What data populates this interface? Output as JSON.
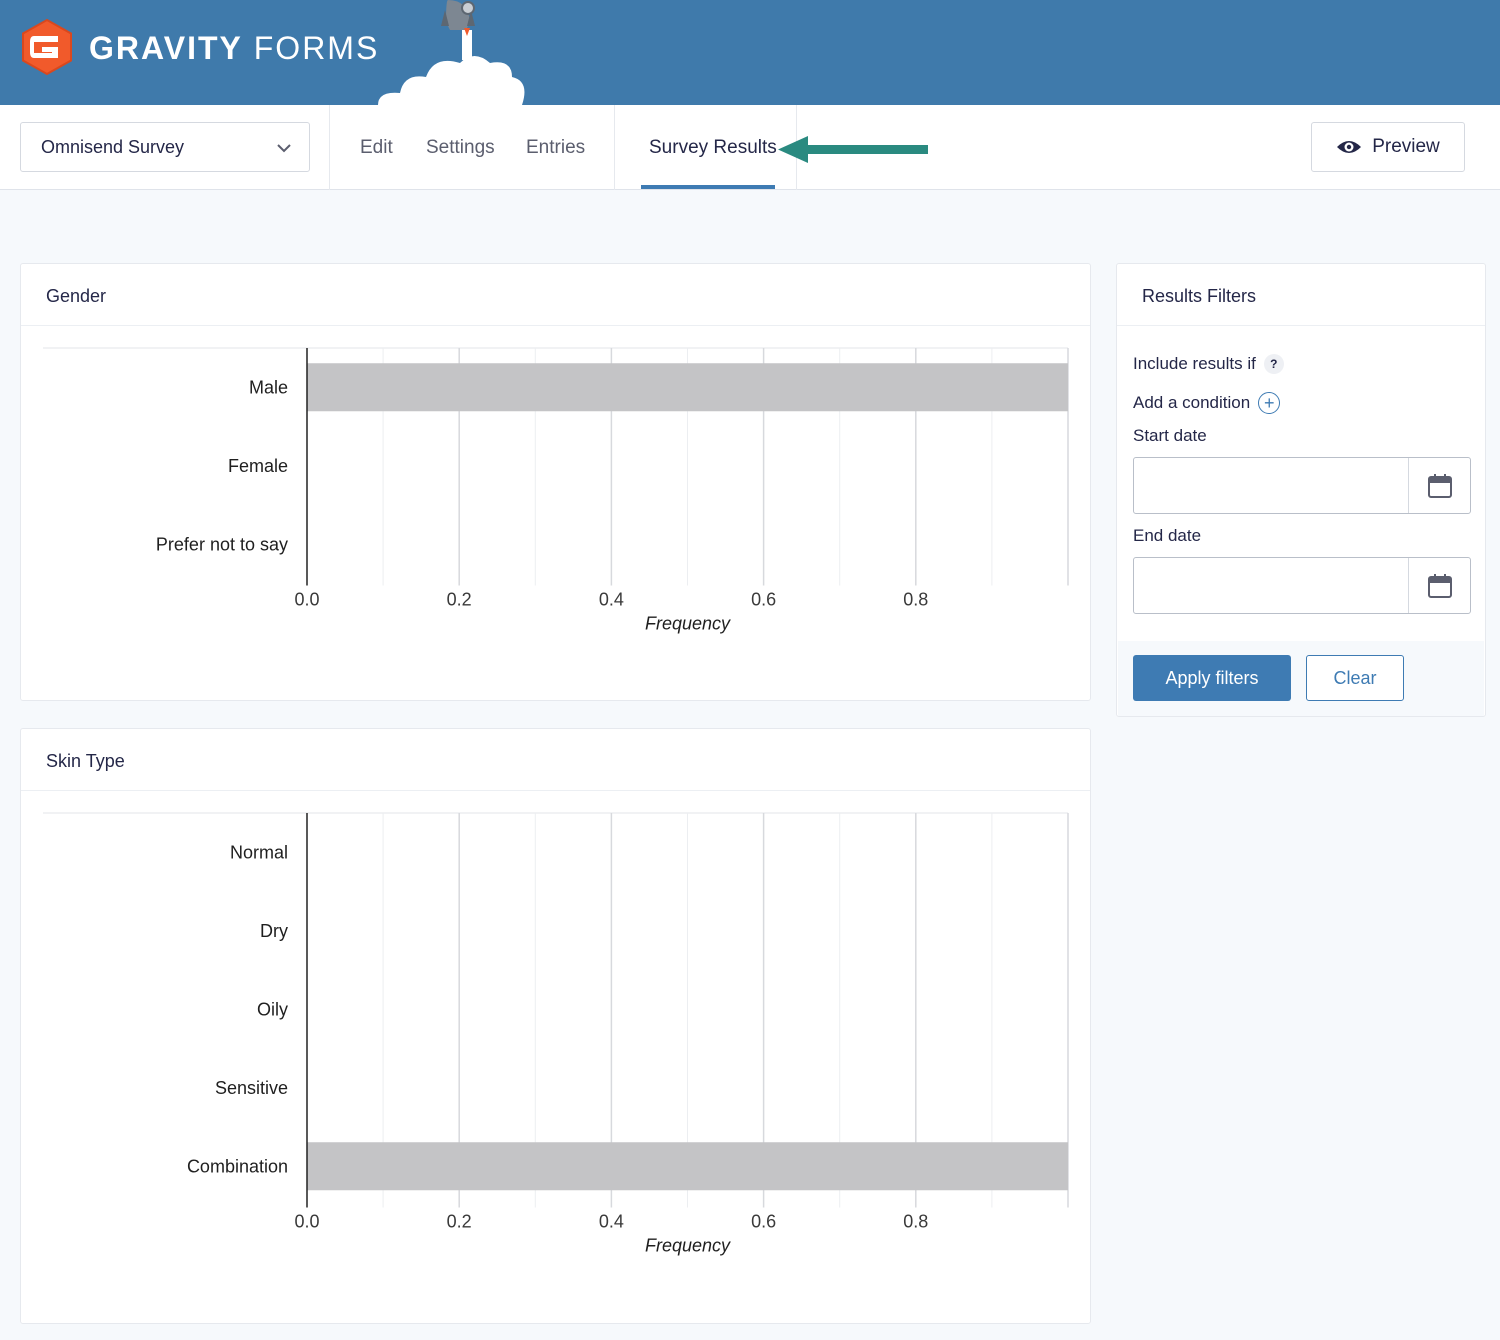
{
  "brand": {
    "name_bold": "GRAVITY",
    "name_light": "FORMS"
  },
  "toolbar": {
    "form_select": "Omnisend Survey",
    "nav": [
      "Edit",
      "Settings",
      "Entries",
      "Survey Results"
    ],
    "active_tab": "Survey Results",
    "preview_label": "Preview"
  },
  "colors": {
    "banner": "#3f7aab",
    "accent": "#3e7bb3",
    "bar": "#c4c4c6",
    "annotation_arrow": "#2a8a80",
    "logo": "#f15a2b"
  },
  "icons": [
    "gravity-forms-logo-icon",
    "rocket-icon",
    "chevron-down-icon",
    "eye-icon",
    "arrow-left-icon",
    "help-icon",
    "plus-icon",
    "calendar-icon"
  ],
  "chart_data": [
    {
      "type": "bar",
      "orientation": "horizontal",
      "title": "Gender",
      "categories": [
        "Male",
        "Female",
        "Prefer not to say"
      ],
      "values": [
        1,
        0,
        0
      ],
      "xlabel": "Frequency",
      "xticks": [
        "0.0",
        "0.2",
        "0.4",
        "0.6",
        "0.8"
      ],
      "xlim": [
        0,
        1
      ],
      "grid": true
    },
    {
      "type": "bar",
      "orientation": "horizontal",
      "title": "Skin Type",
      "categories": [
        "Normal",
        "Dry",
        "Oily",
        "Sensitive",
        "Combination"
      ],
      "values": [
        0,
        0,
        0,
        0,
        1
      ],
      "xlabel": "Frequency",
      "xticks": [
        "0.0",
        "0.2",
        "0.4",
        "0.6",
        "0.8"
      ],
      "xlim": [
        0,
        1
      ],
      "grid": true
    }
  ],
  "filters": {
    "title": "Results Filters",
    "include_label": "Include results if",
    "help": "?",
    "add_condition": "Add a condition",
    "start_label": "Start date",
    "start_value": "",
    "end_label": "End date",
    "end_value": "",
    "apply_label": "Apply filters",
    "clear_label": "Clear"
  }
}
